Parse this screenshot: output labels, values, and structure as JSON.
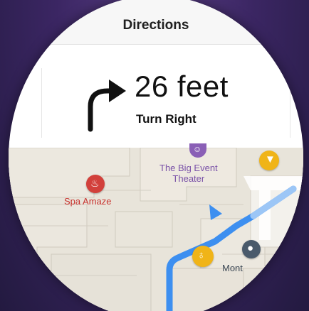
{
  "header": {
    "title": "Directions"
  },
  "directions": {
    "distance": "26 feet",
    "instruction": "Turn Right",
    "arrow_icon": "turn-right-arrow-icon"
  },
  "map": {
    "pois": [
      {
        "label": "Spa Amaze",
        "icon": "spa-icon",
        "color": "#d2403b"
      },
      {
        "label_line1": "The Big Event",
        "label_line2": "Theater",
        "icon": "theater-icon",
        "color": "#8a5fb6"
      },
      {
        "label": "Mont",
        "icon": "info-icon",
        "color": "#4a5a6b"
      },
      {
        "icon": "food-icon",
        "color": "#f0b418"
      },
      {
        "icon": "restroom-icon",
        "color": "#f0b418"
      }
    ],
    "route_color": "#3d8ff0"
  }
}
